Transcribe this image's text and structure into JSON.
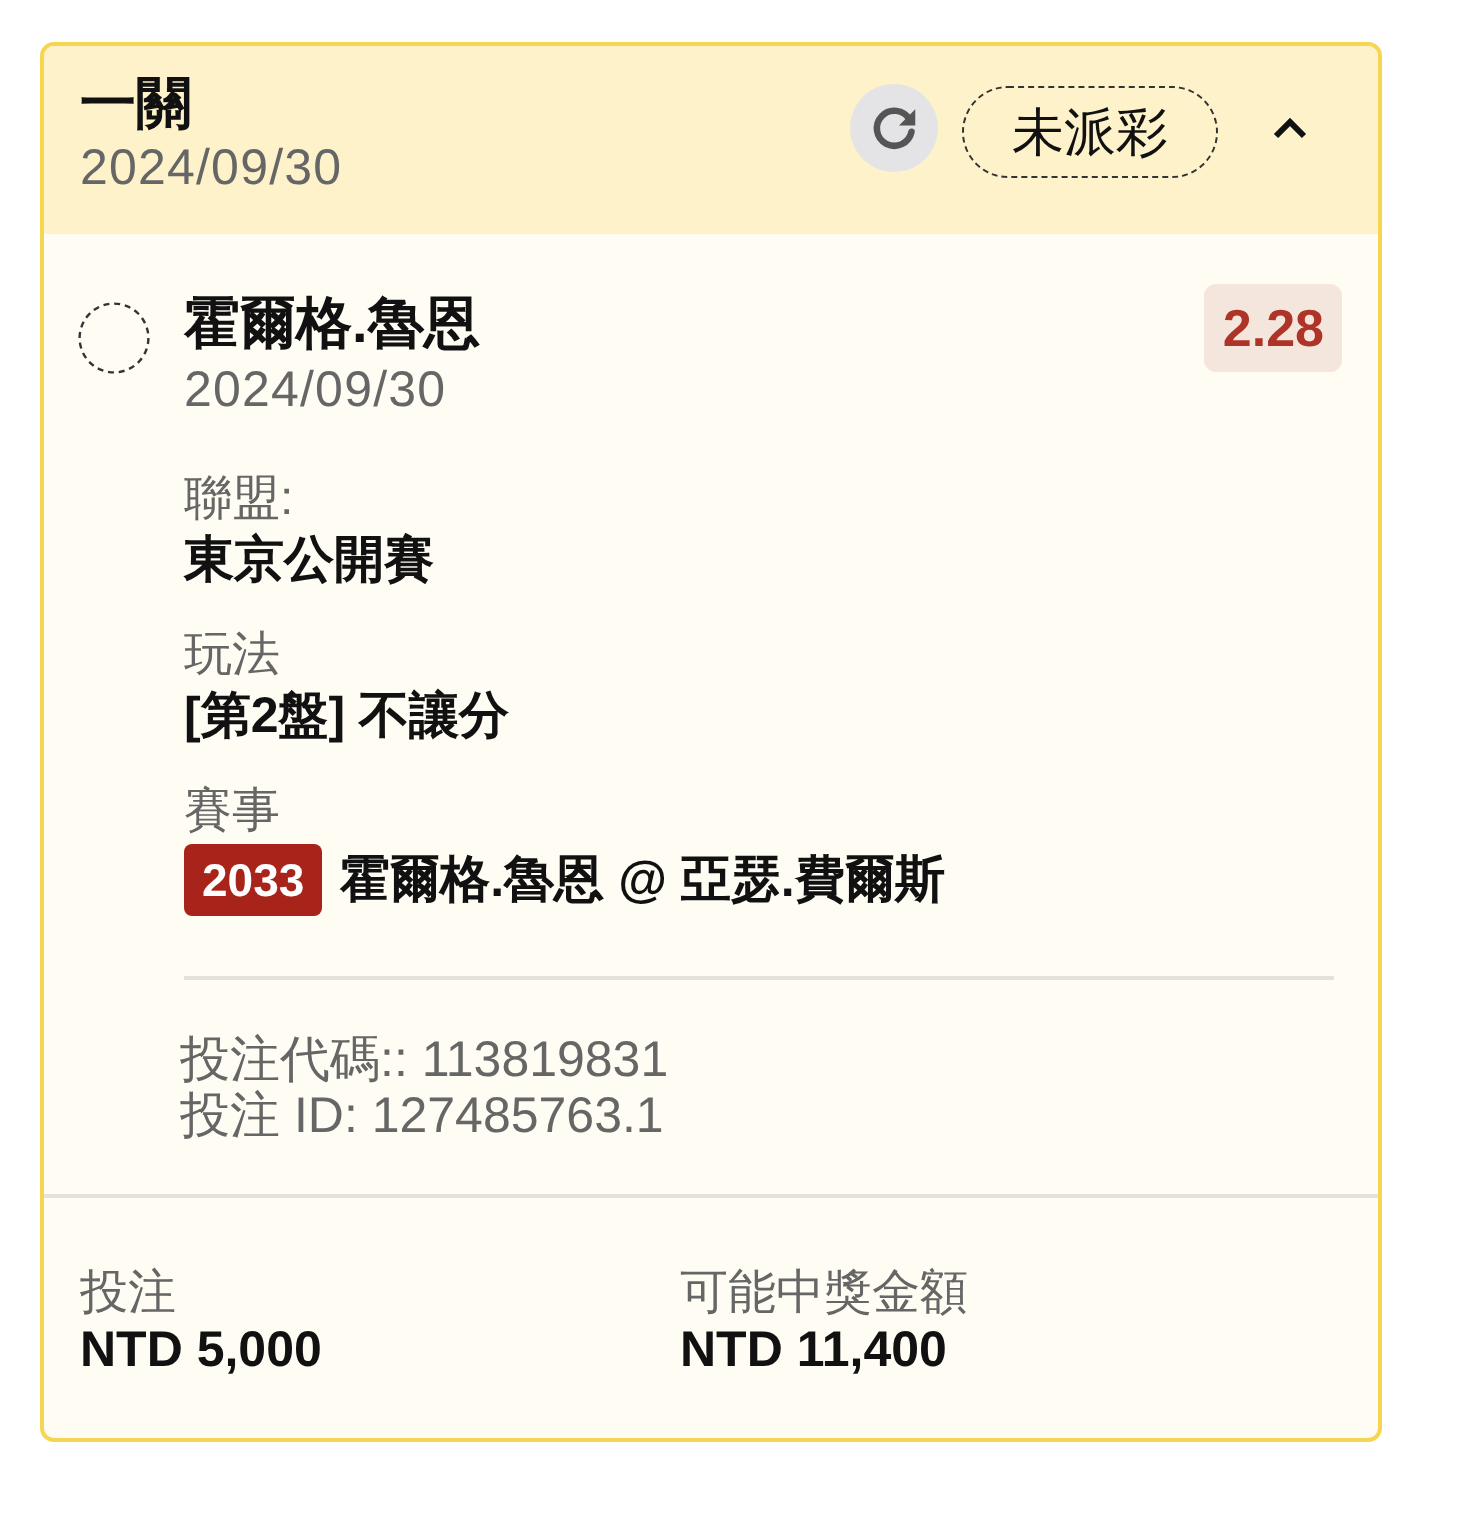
{
  "ticket": {
    "title": "一關",
    "date": "2024/09/30",
    "status": "未派彩",
    "expanded": true
  },
  "selection": {
    "name": "霍爾格.魯恩",
    "date": "2024/09/30",
    "odds": "2.28",
    "details": [
      {
        "kind": "text",
        "label": "聯盟:",
        "value": "東京公開賽"
      },
      {
        "kind": "text",
        "label": "玩法",
        "value": "[第2盤] 不讓分"
      },
      {
        "kind": "event",
        "label": "賽事",
        "code": "2033",
        "value": "霍爾格.魯恩 @ 亞瑟.費爾斯"
      }
    ],
    "bet_code": "投注代碼:: 113819831",
    "bet_id": "投注 ID: 127485763.1"
  },
  "summary": [
    {
      "label": "投注",
      "value": "NTD 5,000"
    },
    {
      "label": "可能中獎金額",
      "value": "NTD 11,400"
    }
  ]
}
